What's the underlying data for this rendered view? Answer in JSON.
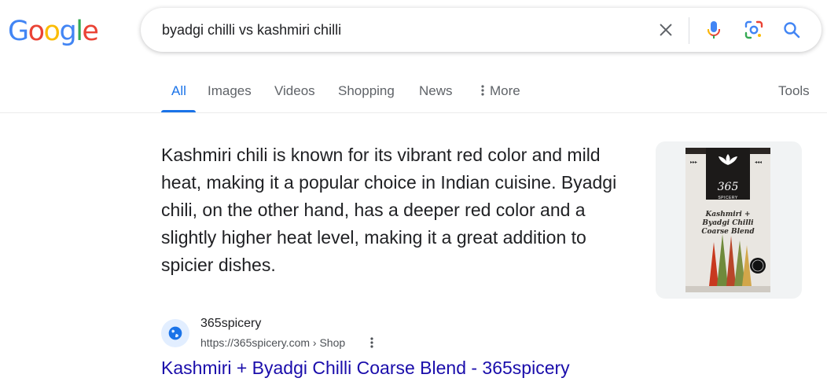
{
  "logo": {
    "letters": [
      "G",
      "o",
      "o",
      "g",
      "l",
      "e"
    ],
    "colors": [
      "#4285f4",
      "#ea4335",
      "#fbbc05",
      "#4285f4",
      "#34a853",
      "#ea4335"
    ]
  },
  "search": {
    "query": "byadgi chilli vs kashmiri chilli",
    "icons": [
      "close-icon",
      "mic-icon",
      "camera-lens-icon",
      "search-icon"
    ]
  },
  "tabs": {
    "items": [
      {
        "label": "All",
        "active": true
      },
      {
        "label": "Images"
      },
      {
        "label": "Videos"
      },
      {
        "label": "Shopping"
      },
      {
        "label": "News"
      },
      {
        "label": "More",
        "icon": "more-vertical-icon"
      }
    ],
    "tools": "Tools",
    "active_color": "#1a73e8"
  },
  "answer": {
    "text": "Kashmiri chili is known for its vibrant red color and mild heat, making it a popular choice in Indian cuisine. Byadgi chili, on the other hand, has a deeper red color and a slightly higher heat level, making it a great addition to spicier dishes."
  },
  "product_image": {
    "brand": "365",
    "brand_sub": "SPICERY",
    "title": "Kashmiri + Byadgi Chilli Coarse Blend"
  },
  "result": {
    "site_name": "365spicery",
    "url": "https://365spicery.com › Shop",
    "title": "Kashmiri + Byadgi Chilli Coarse Blend - 365spicery",
    "favicon": "globe-icon",
    "link_color": "#1a0dab"
  }
}
